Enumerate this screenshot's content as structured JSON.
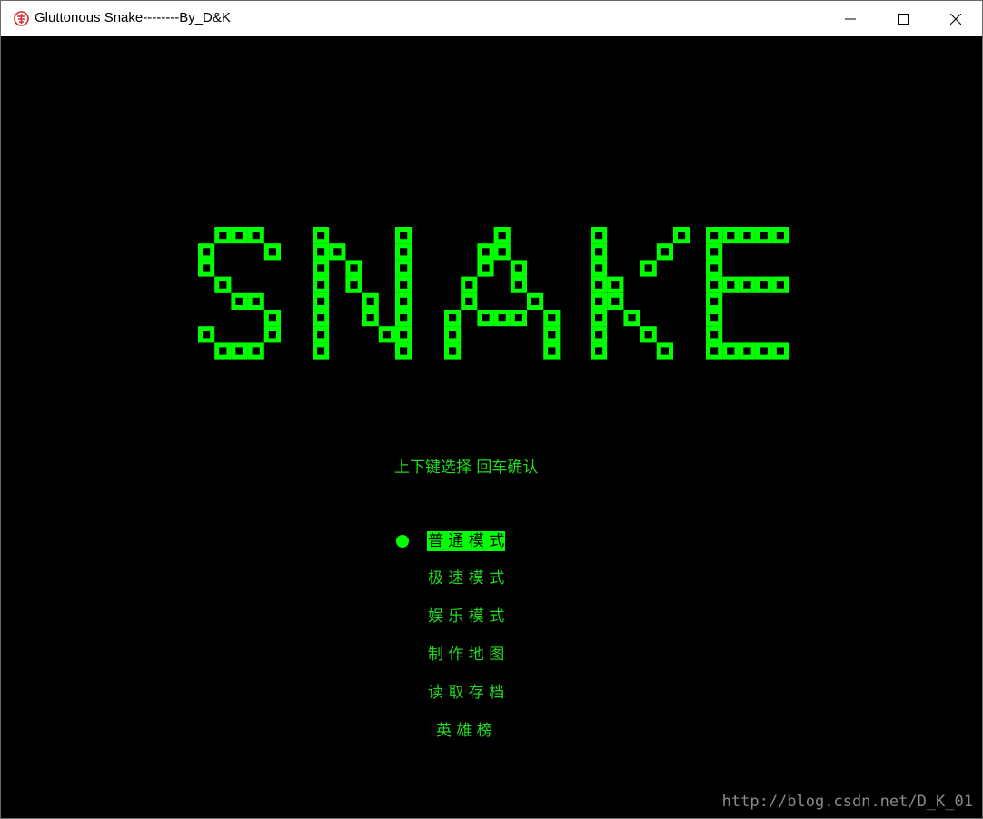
{
  "window": {
    "title": "Gluttonous Snake--------By_D&K",
    "controls": [
      "minimize-icon",
      "maximize-icon",
      "close-icon"
    ]
  },
  "logo": {
    "text": "SNAKE",
    "color": "#00ff00"
  },
  "hint": "上下键选择   回车确认",
  "menu": {
    "selected_index": 0,
    "items": [
      {
        "label": "普 通 模 式"
      },
      {
        "label": "极 速 模 式"
      },
      {
        "label": "娱 乐 模 式"
      },
      {
        "label": "制 作 地 图"
      },
      {
        "label": "读 取 存 档"
      },
      {
        "label": "英 雄 榜"
      }
    ]
  },
  "watermark": "http://blog.csdn.net/D_K_01",
  "colors": {
    "background": "#000000",
    "accent": "#00ff00",
    "text": "#21d921"
  }
}
